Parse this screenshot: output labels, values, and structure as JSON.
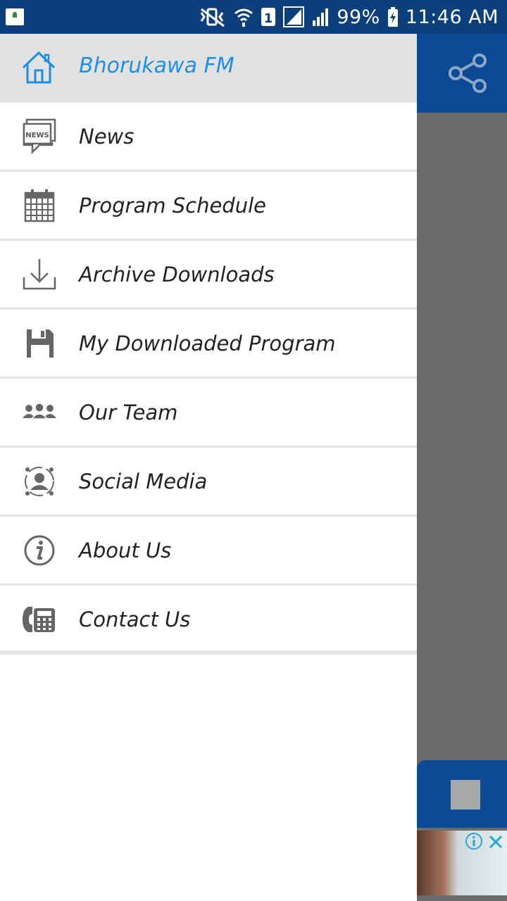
{
  "status_bar": {
    "battery_percent": "99%",
    "time": "11:46 AM",
    "icons": [
      "app-icon",
      "mute-vibrate-icon",
      "wifi-icon",
      "sim-1-icon",
      "signal-icon",
      "signal-icon",
      "battery-charging-icon"
    ]
  },
  "drawer": {
    "header": {
      "title": "Bhorukawa FM",
      "icon": "home-icon"
    },
    "items": [
      {
        "label": "News",
        "icon": "news-icon"
      },
      {
        "label": "Program Schedule",
        "icon": "calendar-icon"
      },
      {
        "label": "Archive Downloads",
        "icon": "download-icon"
      },
      {
        "label": "My Downloaded Program",
        "icon": "save-icon"
      },
      {
        "label": "Our Team",
        "icon": "team-icon"
      },
      {
        "label": "Social Media",
        "icon": "social-media-icon"
      },
      {
        "label": "About Us",
        "icon": "info-icon"
      },
      {
        "label": "Contact Us",
        "icon": "phone-icon"
      }
    ]
  },
  "colors": {
    "status_bar": "#0d3f7c",
    "toolbar": "#0d4a94",
    "header_title": "#1e8fe6",
    "header_bg": "#e2e2e2",
    "scrim": "#6b6b6b"
  }
}
